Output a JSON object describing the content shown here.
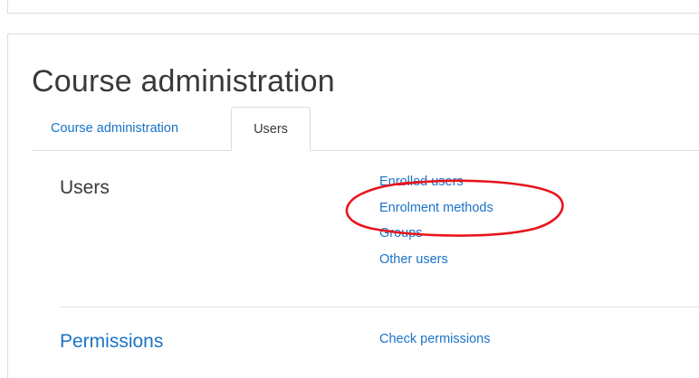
{
  "page": {
    "title": "Course administration"
  },
  "tabs": [
    {
      "label": "Course administration"
    },
    {
      "label": "Users"
    }
  ],
  "sections": {
    "users": {
      "heading": "Users",
      "links": [
        "Enrolled users",
        "Enrolment methods",
        "Groups",
        "Other users"
      ]
    },
    "permissions": {
      "heading": "Permissions",
      "links": [
        "Check permissions"
      ]
    }
  },
  "colors": {
    "link": "#1a73c8",
    "text": "#373a3c",
    "border": "#dcdcdc",
    "annotation": "#e8141c"
  }
}
